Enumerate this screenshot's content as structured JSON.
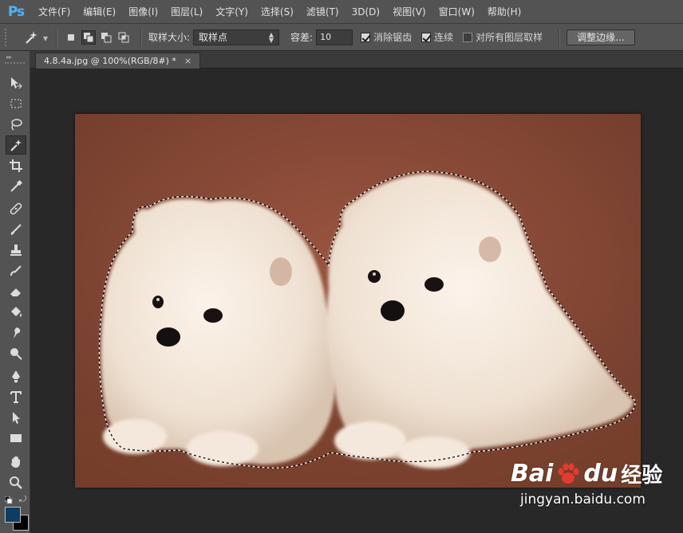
{
  "app": {
    "logo": "Ps",
    "accent": "#4fb3ff"
  },
  "menu": [
    {
      "label": "文件(F)"
    },
    {
      "label": "编辑(E)"
    },
    {
      "label": "图像(I)"
    },
    {
      "label": "图层(L)"
    },
    {
      "label": "文字(Y)"
    },
    {
      "label": "选择(S)"
    },
    {
      "label": "滤镜(T)"
    },
    {
      "label": "3D(D)"
    },
    {
      "label": "视图(V)"
    },
    {
      "label": "窗口(W)"
    },
    {
      "label": "帮助(H)"
    }
  ],
  "options": {
    "tool_icon": "magic-wand-icon",
    "sample_size_label": "取样大小:",
    "sample_size_value": "取样点",
    "tolerance_label": "容差:",
    "tolerance_value": "10",
    "anti_alias_label": "消除锯齿",
    "anti_alias_checked": true,
    "contiguous_label": "连续",
    "contiguous_checked": true,
    "sample_all_layers_label": "对所有图层取样",
    "sample_all_layers_checked": false,
    "refine_edge_label": "调整边缘..."
  },
  "document": {
    "tab_title": "4.8.4a.jpg @ 100%(RGB/8#) *",
    "close": "×"
  },
  "tools": [
    {
      "name": "move-tool-icon"
    },
    {
      "name": "marquee-tool-icon"
    },
    {
      "name": "lasso-tool-icon"
    },
    {
      "name": "magic-wand-tool-icon",
      "active": true
    },
    {
      "name": "crop-tool-icon"
    },
    {
      "name": "eyedropper-tool-icon"
    },
    {
      "name": "healing-brush-tool-icon"
    },
    {
      "name": "brush-tool-icon"
    },
    {
      "name": "clone-stamp-tool-icon"
    },
    {
      "name": "history-brush-tool-icon"
    },
    {
      "name": "eraser-tool-icon"
    },
    {
      "name": "paint-bucket-tool-icon"
    },
    {
      "name": "smudge-tool-icon"
    },
    {
      "name": "dodge-tool-icon"
    },
    {
      "name": "pen-tool-icon"
    },
    {
      "name": "type-tool-icon"
    },
    {
      "name": "path-selection-tool-icon"
    },
    {
      "name": "rectangle-tool-icon"
    },
    {
      "name": "hand-tool-icon"
    },
    {
      "name": "zoom-tool-icon"
    }
  ],
  "colors": {
    "foreground": "#0e3d63",
    "background": "#000000",
    "photo_bg": "#8a4a33"
  },
  "watermark": {
    "brand_left": "Bai",
    "brand_right": "du",
    "product": "经验",
    "url": "jingyan.baidu.com"
  }
}
